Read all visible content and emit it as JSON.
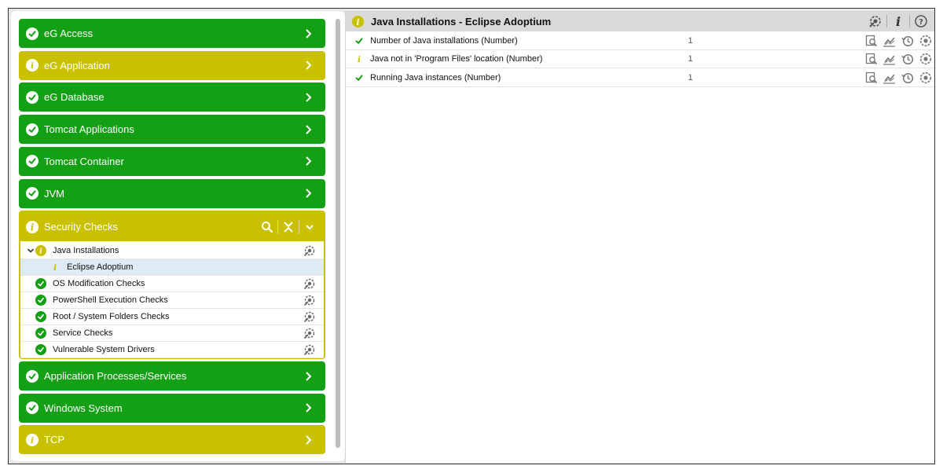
{
  "colors": {
    "ok": "#14a014",
    "warn": "#c9c000",
    "header_bg": "#d9d9d9"
  },
  "sidebar": {
    "tiles_top": [
      {
        "label": "eG Access",
        "status": "ok"
      },
      {
        "label": "eG Application",
        "status": "warn"
      },
      {
        "label": "eG Database",
        "status": "ok"
      },
      {
        "label": "Tomcat Applications",
        "status": "ok"
      },
      {
        "label": "Tomcat Container",
        "status": "ok"
      },
      {
        "label": "JVM",
        "status": "ok"
      }
    ],
    "expanded": {
      "label": "Security Checks",
      "status": "warn",
      "actions": [
        "search-icon",
        "collapse-all-icon",
        "chevron-down-icon"
      ],
      "tree": [
        {
          "label": "Java Installations",
          "status": "warn",
          "expanded": true
        },
        {
          "label": "Eclipse Adoptium",
          "status": "warn",
          "selected": true,
          "child": true
        },
        {
          "label": "OS Modification Checks",
          "status": "ok"
        },
        {
          "label": "PowerShell Execution Checks",
          "status": "ok"
        },
        {
          "label": "Root / System Folders Checks",
          "status": "ok"
        },
        {
          "label": "Service Checks",
          "status": "ok"
        },
        {
          "label": "Vulnerable System Drivers",
          "status": "ok"
        }
      ]
    },
    "tiles_bottom": [
      {
        "label": "Application Processes/Services",
        "status": "ok"
      },
      {
        "label": "Windows System",
        "status": "ok"
      },
      {
        "label": "TCP",
        "status": "warn"
      }
    ]
  },
  "main": {
    "title": "Java Installations - Eclipse Adoptium",
    "header_actions": [
      "test-settings-icon",
      "info-icon",
      "help-icon"
    ],
    "measures": [
      {
        "name": "Number of Java installations (Number)",
        "value": "1",
        "status": "ok"
      },
      {
        "name": "Java not in 'Program Files' location (Number)",
        "value": "1",
        "status": "warn"
      },
      {
        "name": "Running Java instances (Number)",
        "value": "1",
        "status": "ok"
      }
    ],
    "row_actions": [
      "detailed-diagnosis-icon",
      "graph-icon",
      "history-icon",
      "threshold-icon"
    ]
  }
}
